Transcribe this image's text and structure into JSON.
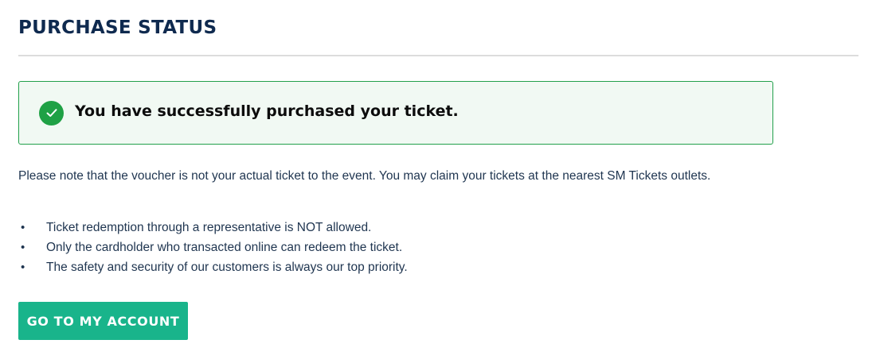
{
  "header": {
    "title": "PURCHASE STATUS"
  },
  "alert": {
    "icon": "check-circle-icon",
    "message": "You have successfully purchased your ticket.",
    "accent_color": "#1fa145",
    "background_color": "#f1f9f3"
  },
  "content": {
    "note": "Please note that the voucher is not your actual ticket to the event. You may claim your tickets at the nearest SM Tickets outlets.",
    "bullets": [
      "Ticket redemption through a representative is NOT allowed.",
      "Only the cardholder who transacted online can redeem the ticket.",
      "The safety and security of our customers is always our top priority."
    ]
  },
  "actions": {
    "primary_label": "GO TO MY ACCOUNT",
    "primary_color": "#19b48b"
  }
}
